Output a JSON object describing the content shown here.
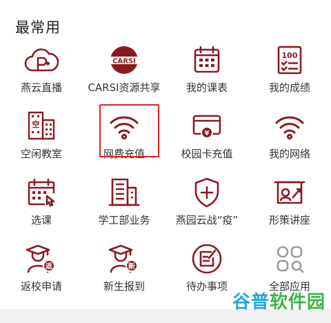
{
  "section": {
    "title": "最常用"
  },
  "colors": {
    "icon": "#8b1a1f",
    "highlight": "#e02020"
  },
  "apps": [
    {
      "label": "燕云直播",
      "icon": "cloud-live-icon"
    },
    {
      "label": "CARSI资源共享",
      "icon": "carsi-icon",
      "badge": "CARSI"
    },
    {
      "label": "我的课表",
      "icon": "calendar-icon"
    },
    {
      "label": "我的成绩",
      "icon": "grades-icon",
      "badge": "100"
    },
    {
      "label": "空闲教室",
      "icon": "classroom-icon",
      "badge": "空"
    },
    {
      "label": "网费充值",
      "icon": "wifi-icon"
    },
    {
      "label": "校园卡充值",
      "icon": "campus-card-icon",
      "badge": "¥"
    },
    {
      "label": "我的网络",
      "icon": "network-icon"
    },
    {
      "label": "选课",
      "icon": "course-select-icon"
    },
    {
      "label": "学工部业务",
      "icon": "building-icon"
    },
    {
      "label": "燕园云战“疫”",
      "icon": "shield-plus-icon"
    },
    {
      "label": "形策讲座",
      "icon": "lecture-icon"
    },
    {
      "label": "返校申请",
      "icon": "return-school-icon",
      "badge": "返"
    },
    {
      "label": "新生报到",
      "icon": "freshman-icon",
      "badge": "新"
    },
    {
      "label": "待办事项",
      "icon": "todo-icon"
    },
    {
      "label": "全部应用",
      "icon": "all-apps-icon"
    }
  ],
  "watermark": {
    "part1": "谷普",
    "part2": "软件园"
  }
}
